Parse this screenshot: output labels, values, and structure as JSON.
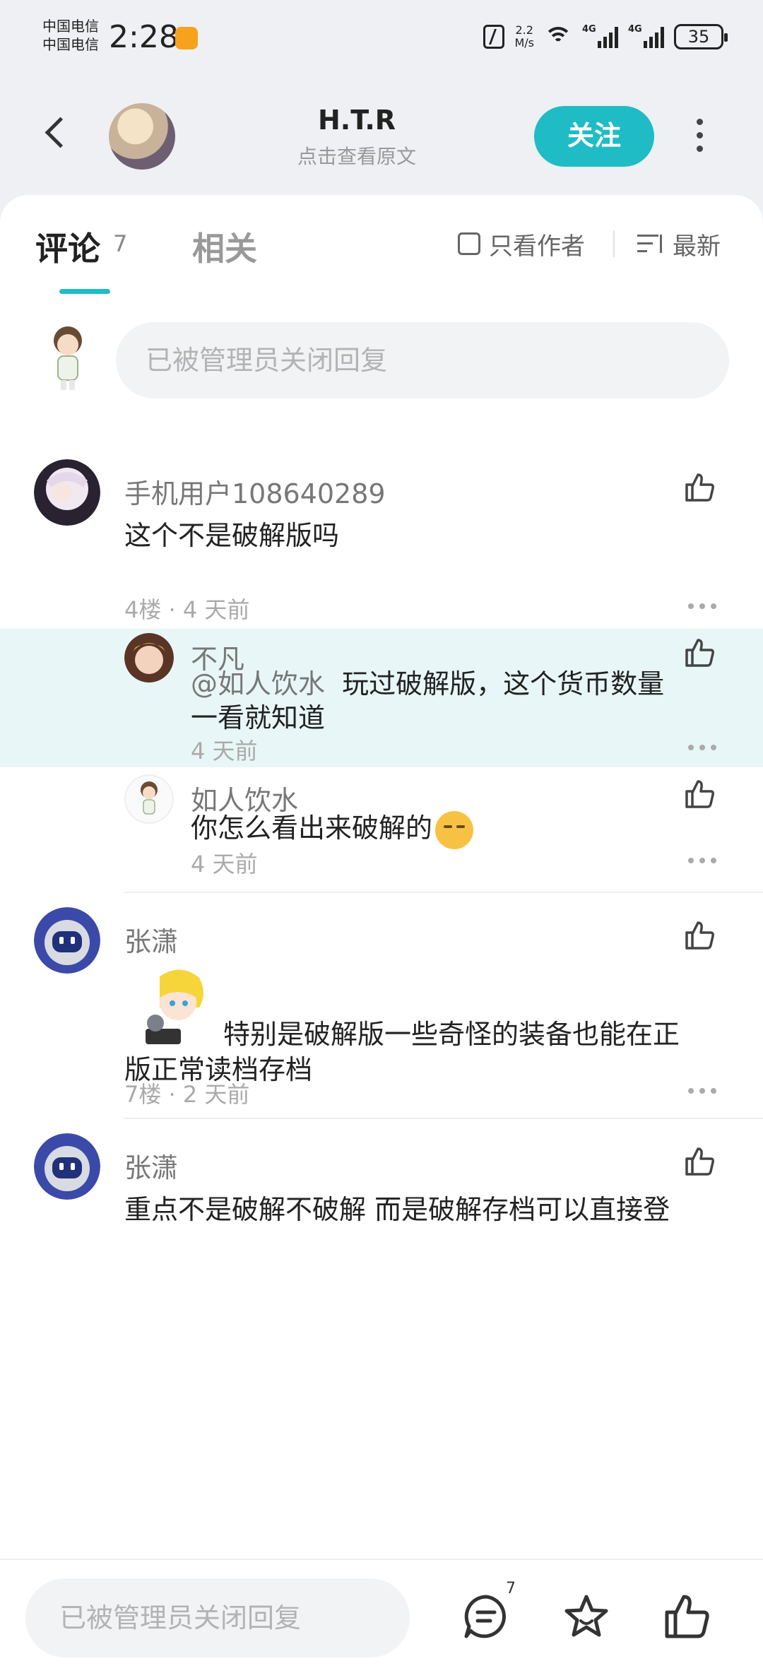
{
  "status_bar": {
    "carrier_1": "中国电信",
    "carrier_2": "中国电信",
    "time": "2:28",
    "net_speed_value": "2.2",
    "net_speed_unit": "M/s",
    "signal_1": "4G",
    "signal_2": "4G",
    "battery": "35"
  },
  "header": {
    "title": "H.T.R",
    "subtitle": "点击查看原文",
    "follow_label": "关注"
  },
  "tabs": {
    "comments_label": "评论",
    "comments_count": "7",
    "related_label": "相关",
    "author_only_label": "只看作者",
    "sort_label": "最新"
  },
  "composer": {
    "placeholder": "已被管理员关闭回复"
  },
  "comments": [
    {
      "author": "手机用户108640289",
      "text": "这个不是破解版吗",
      "meta": "4楼 · 4 天前",
      "replies": [
        {
          "author": "不凡",
          "mention": "@如人饮水",
          "text_1": "玩过破解版，这个货币数量",
          "text_2": "一看就知道",
          "meta": "4 天前"
        },
        {
          "author": "如人饮水",
          "text": "你怎么看出来破解的",
          "meta": "4 天前"
        }
      ]
    },
    {
      "author": "张潇",
      "text_1": "特别是破解版一些奇怪的装备也能在正",
      "text_2": "版正常读档存档",
      "meta": "7楼 · 2 天前"
    },
    {
      "author": "张潇",
      "text": "重点不是破解不破解 而是破解存档可以直接登"
    }
  ],
  "bottom_bar": {
    "placeholder": "已被管理员关闭回复",
    "comment_count": "7",
    "icons": [
      "comment-icon",
      "star-icon",
      "thumb-up-icon"
    ]
  },
  "colors": {
    "accent": "#1fbcc6",
    "highlight": "#e8f6f7"
  }
}
